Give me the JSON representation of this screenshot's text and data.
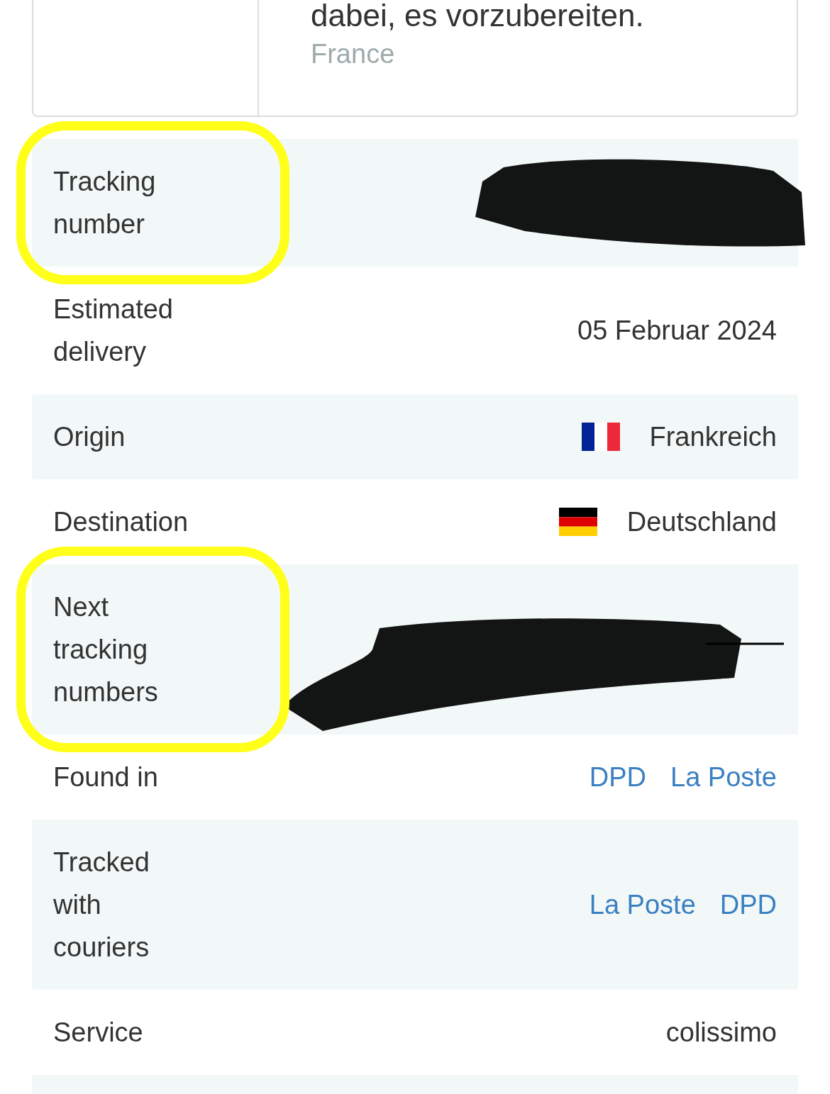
{
  "card": {
    "text": "dabei, es vorzubereiten.",
    "country": "France"
  },
  "rows": [
    {
      "label": "Tracking number",
      "kind": "redacted",
      "highlighted": true
    },
    {
      "label": "Estimated delivery",
      "kind": "text",
      "value": "05 Februar 2024",
      "highlighted": false
    },
    {
      "label": "Origin",
      "kind": "country",
      "value": "Frankreich",
      "highlighted": false
    },
    {
      "label": "Destination",
      "kind": "country",
      "value": "Deutschland",
      "highlighted": false
    },
    {
      "label": "Next tracking numbers",
      "kind": "redacted",
      "highlighted": true
    },
    {
      "label": "Found in",
      "kind": "links",
      "links": [
        "DPD",
        "La Poste"
      ],
      "highlighted": false
    },
    {
      "label": "Tracked with couriers",
      "kind": "links",
      "links": [
        "La Poste",
        "DPD"
      ],
      "highlighted": false
    },
    {
      "label": "Service",
      "kind": "text",
      "value": "colissimo",
      "highlighted": false
    }
  ]
}
